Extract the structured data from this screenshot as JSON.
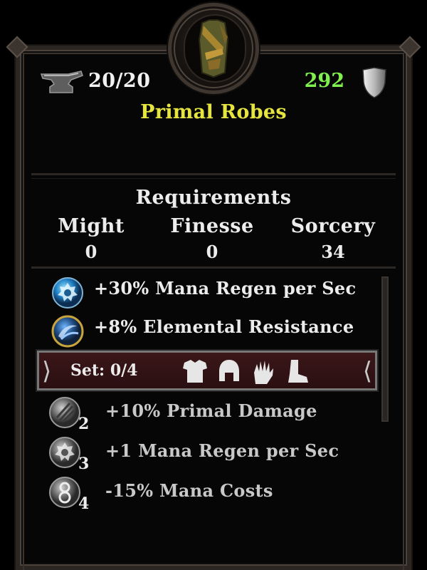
{
  "item": {
    "durability": "20/20",
    "armor_value": "292",
    "name": "Primal Robes",
    "armor_color": "#7ff04e",
    "name_color": "#e6e43e"
  },
  "requirements": {
    "title": "Requirements",
    "stats": [
      {
        "name": "Might",
        "value": "0"
      },
      {
        "name": "Finesse",
        "value": "0"
      },
      {
        "name": "Sorcery",
        "value": "34"
      }
    ]
  },
  "bonuses": [
    {
      "icon": "blue-gear-gem-icon",
      "text": "+30% Mana Regen per Sec"
    },
    {
      "icon": "gold-swirl-gem-icon",
      "text": "+8% Elemental Resistance"
    }
  ],
  "set": {
    "label": "Set: 0/4",
    "pieces": [
      "chest-armor-icon",
      "helmet-icon",
      "glove-icon",
      "boot-icon"
    ],
    "bonuses": [
      {
        "count": "2",
        "icon": "grey-claw-gem-icon",
        "text": "+10% Primal Damage"
      },
      {
        "count": "3",
        "icon": "grey-gear-gem-icon",
        "text": "+1 Mana Regen per Sec"
      },
      {
        "count": "4",
        "icon": "grey-eight-gem-icon",
        "text": "-15% Mana Costs"
      }
    ]
  }
}
